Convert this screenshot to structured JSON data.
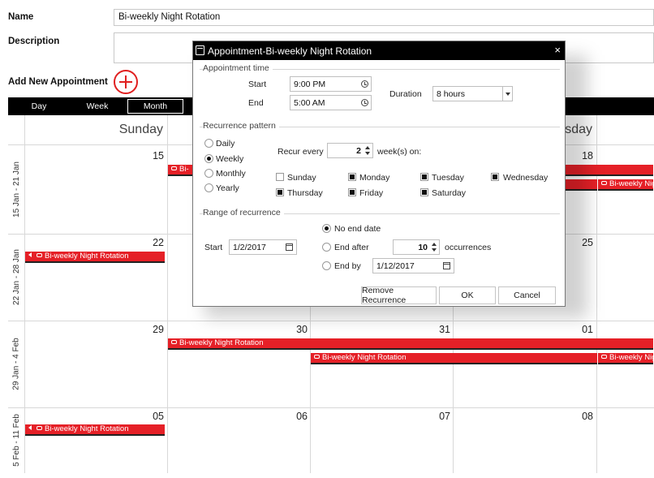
{
  "form": {
    "name_label": "Name",
    "name_value": "Bi-weekly Night Rotation",
    "description_label": "Description",
    "description_value": "",
    "add_new_label": "Add New Appointment"
  },
  "views": [
    "Day",
    "Week",
    "Month"
  ],
  "active_view": "Month",
  "calendar": {
    "headers": [
      "Sunday",
      "sday"
    ],
    "weeks": [
      {
        "label": "15 Jan - 21 Jan",
        "dates": [
          "15",
          "",
          "",
          "18"
        ]
      },
      {
        "label": "22 Jan - 28 Jan",
        "dates": [
          "22",
          "",
          "",
          "25"
        ]
      },
      {
        "label": "29 Jan - 4 Feb",
        "dates": [
          "29",
          "30",
          "31",
          "01"
        ]
      },
      {
        "label": "5 Feb - 11 Feb",
        "dates": [
          "05",
          "06",
          "07",
          "08"
        ]
      }
    ],
    "event_title": "Bi-weekly Night Rotation",
    "event_fragment": "Bi-",
    "event_color": "#e52027"
  },
  "dialog": {
    "title": "Appointment-Bi-weekly Night Rotation",
    "close": "×",
    "appointment_time": {
      "section": "Appointment time",
      "start_label": "Start",
      "start_value": "9:00 PM",
      "end_label": "End",
      "end_value": "5:00 AM",
      "duration_label": "Duration",
      "duration_value": "8 hours"
    },
    "recurrence": {
      "section": "Recurrence pattern",
      "options": [
        "Daily",
        "Weekly",
        "Monthly",
        "Yearly"
      ],
      "selected": "Weekly",
      "recur_every_label": "Recur every",
      "recur_every_value": "2",
      "weeks_on_label": "week(s) on:",
      "days": [
        {
          "label": "Sunday",
          "checked": false
        },
        {
          "label": "Monday",
          "checked": true
        },
        {
          "label": "Tuesday",
          "checked": true
        },
        {
          "label": "Wednesday",
          "checked": true
        },
        {
          "label": "Thursday",
          "checked": true
        },
        {
          "label": "Friday",
          "checked": true
        },
        {
          "label": "Saturday",
          "checked": true
        }
      ]
    },
    "range": {
      "section": "Range of recurrence",
      "start_label": "Start",
      "start_value": "1/2/2017",
      "no_end_label": "No end date",
      "end_after_label": "End after",
      "end_after_value": "10",
      "occurrences_label": "occurrences",
      "end_by_label": "End by",
      "end_by_value": "1/12/2017",
      "selected": "No end date"
    },
    "buttons": {
      "remove": "Remove Recurrence",
      "ok": "OK",
      "cancel": "Cancel"
    }
  }
}
